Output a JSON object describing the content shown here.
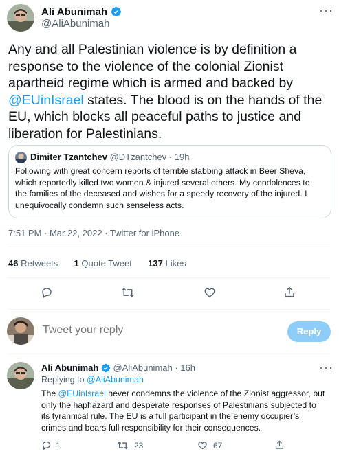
{
  "main_tweet": {
    "author_name": "Ali Abunimah",
    "author_handle": "@AliAbunimah",
    "text_line1": "Any and all Palestinian violence is by definition a",
    "text_line2": "response to the violence of the colonial Zionist",
    "text_line3": "apartheid regime which is armed and backed by",
    "text_mention": "@EUinIsrael",
    "text_line4_rest": " states. The blood is on the hands of the",
    "text_line5": "EU, which blocks all peaceful paths to justice and",
    "text_line6": "liberation for Palestinians.",
    "timestamp": "7:51 PM · Mar 22, 2022 · Twitter for iPhone",
    "retweets_count": "46",
    "retweets_label": "Retweets",
    "quotes_count": "1",
    "quotes_label": "Quote Tweet",
    "likes_count": "137",
    "likes_label": "Likes"
  },
  "quoted_tweet": {
    "author_name": "Dimiter Tzantchev",
    "author_handle": "@DTzantchev",
    "time": "· 19h",
    "line1": "Following with great concern reports of terrible stabbing attack in Beer Sheva,",
    "line2": "which reportedly killed two women & injured several others. My condolences to",
    "line3": "the families of the deceased and wishes for a speedy recovery of the injured. I",
    "line4": "unequivocally condemn such senseless acts."
  },
  "reply_composer": {
    "placeholder": "Tweet your reply",
    "button_label": "Reply"
  },
  "reply_tweet": {
    "author_name": "Ali Abunimah",
    "author_handle": "@AliAbunimah",
    "time": "· 16h",
    "replying_to_label": "Replying to",
    "replying_to_handle": "@AliAbunimah",
    "line1_pre": "The ",
    "line1_mention": "@EUinIsrael",
    "line1_rest": " never condemns the violence of the Zionist aggressor, but",
    "line2": "only the haphazard and desperate responses of Palestinians subjected to",
    "line3": "its tyrannical rule. The EU is a full participant in the enemy occupier’s",
    "line4": "crimes and bears full responsibility for their consequences.",
    "reply_count": "1",
    "retweet_count": "23",
    "like_count": "67"
  },
  "colors": {
    "accent": "#1d9bf0",
    "secondary_text": "#536471",
    "reply_button_disabled": "#8ecdf8"
  },
  "icons": [
    "verified-badge-icon",
    "more-icon",
    "reply-icon",
    "retweet-icon",
    "like-icon",
    "share-icon"
  ]
}
